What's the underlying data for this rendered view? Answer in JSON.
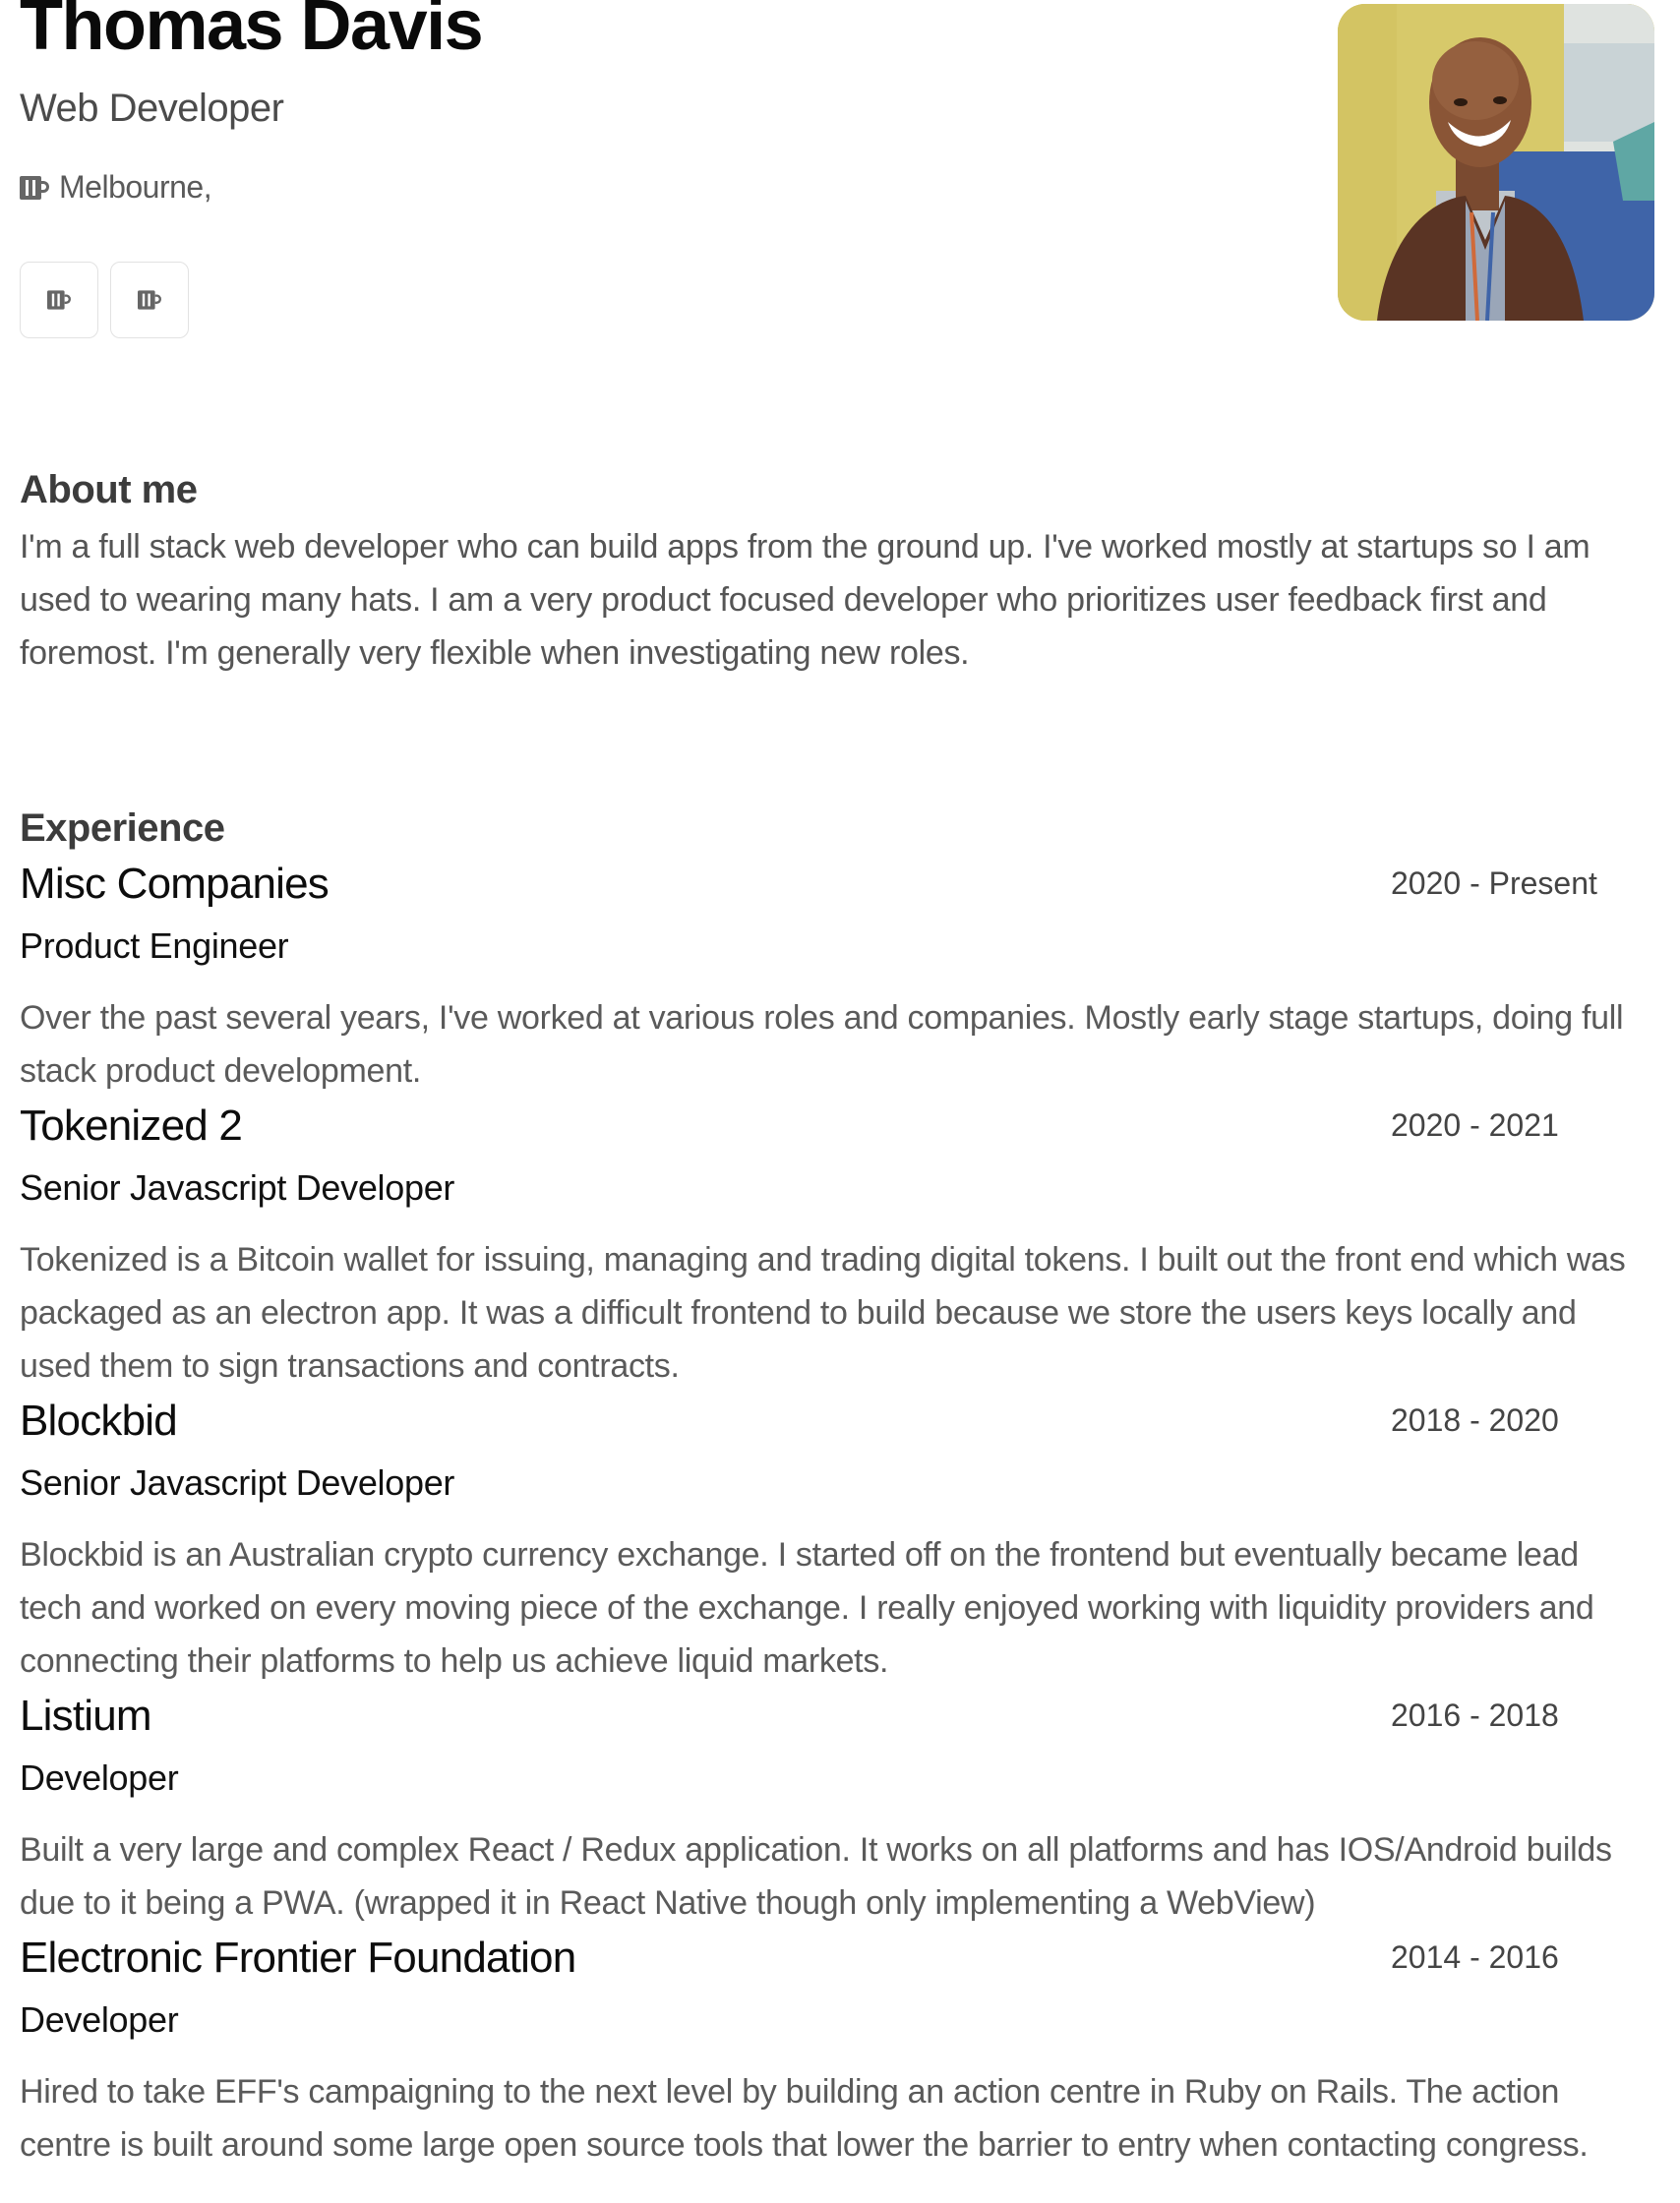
{
  "profile": {
    "name": "Thomas Davis",
    "title": "Web Developer",
    "location": "Melbourne,",
    "location_icon": "mug-icon",
    "social": [
      {
        "icon": "mug-icon"
      },
      {
        "icon": "mug-icon"
      }
    ]
  },
  "about": {
    "heading": "About me",
    "text": "I'm a full stack web developer who can build apps from the ground up. I've worked mostly at startups so I am used to wearing many hats. I am a very product focused developer who prioritizes user feedback first and foremost. I'm generally very flexible when investigating new roles."
  },
  "experience": {
    "heading": "Experience",
    "jobs": [
      {
        "company": "Misc Companies",
        "dates": "2020 - Present",
        "role": "Product Engineer",
        "description": "Over the past several years, I've worked at various roles and companies. Mostly early stage startups, doing full stack product development."
      },
      {
        "company": "Tokenized 2",
        "dates": "2020 - 2021",
        "role": "Senior Javascript Developer",
        "description": "Tokenized is a Bitcoin wallet for issuing, managing and trading digital tokens. I built out the front end which was packaged as an electron app. It was a difficult frontend to build because we store the users keys locally and used them to sign transactions and contracts."
      },
      {
        "company": "Blockbid",
        "dates": "2018 - 2020",
        "role": "Senior Javascript Developer",
        "description": "Blockbid is an Australian crypto currency exchange. I started off on the frontend but eventually became lead tech and worked on every moving piece of the exchange. I really enjoyed working with liquidity providers and connecting their platforms to help us achieve liquid markets."
      },
      {
        "company": "Listium",
        "dates": "2016 - 2018",
        "role": "Developer",
        "description": "Built a very large and complex React / Redux application. It works on all platforms and has IOS/Android builds due to it being a PWA. (wrapped it in React Native though only implementing a WebView)"
      },
      {
        "company": "Electronic Frontier Foundation",
        "dates": "2014 - 2016",
        "role": "Developer",
        "description": "Hired to take EFF's campaigning to the next level by building an action centre in Ruby on Rails. The action centre is built around some large open source tools that lower the barrier to entry when contacting congress."
      }
    ]
  }
}
